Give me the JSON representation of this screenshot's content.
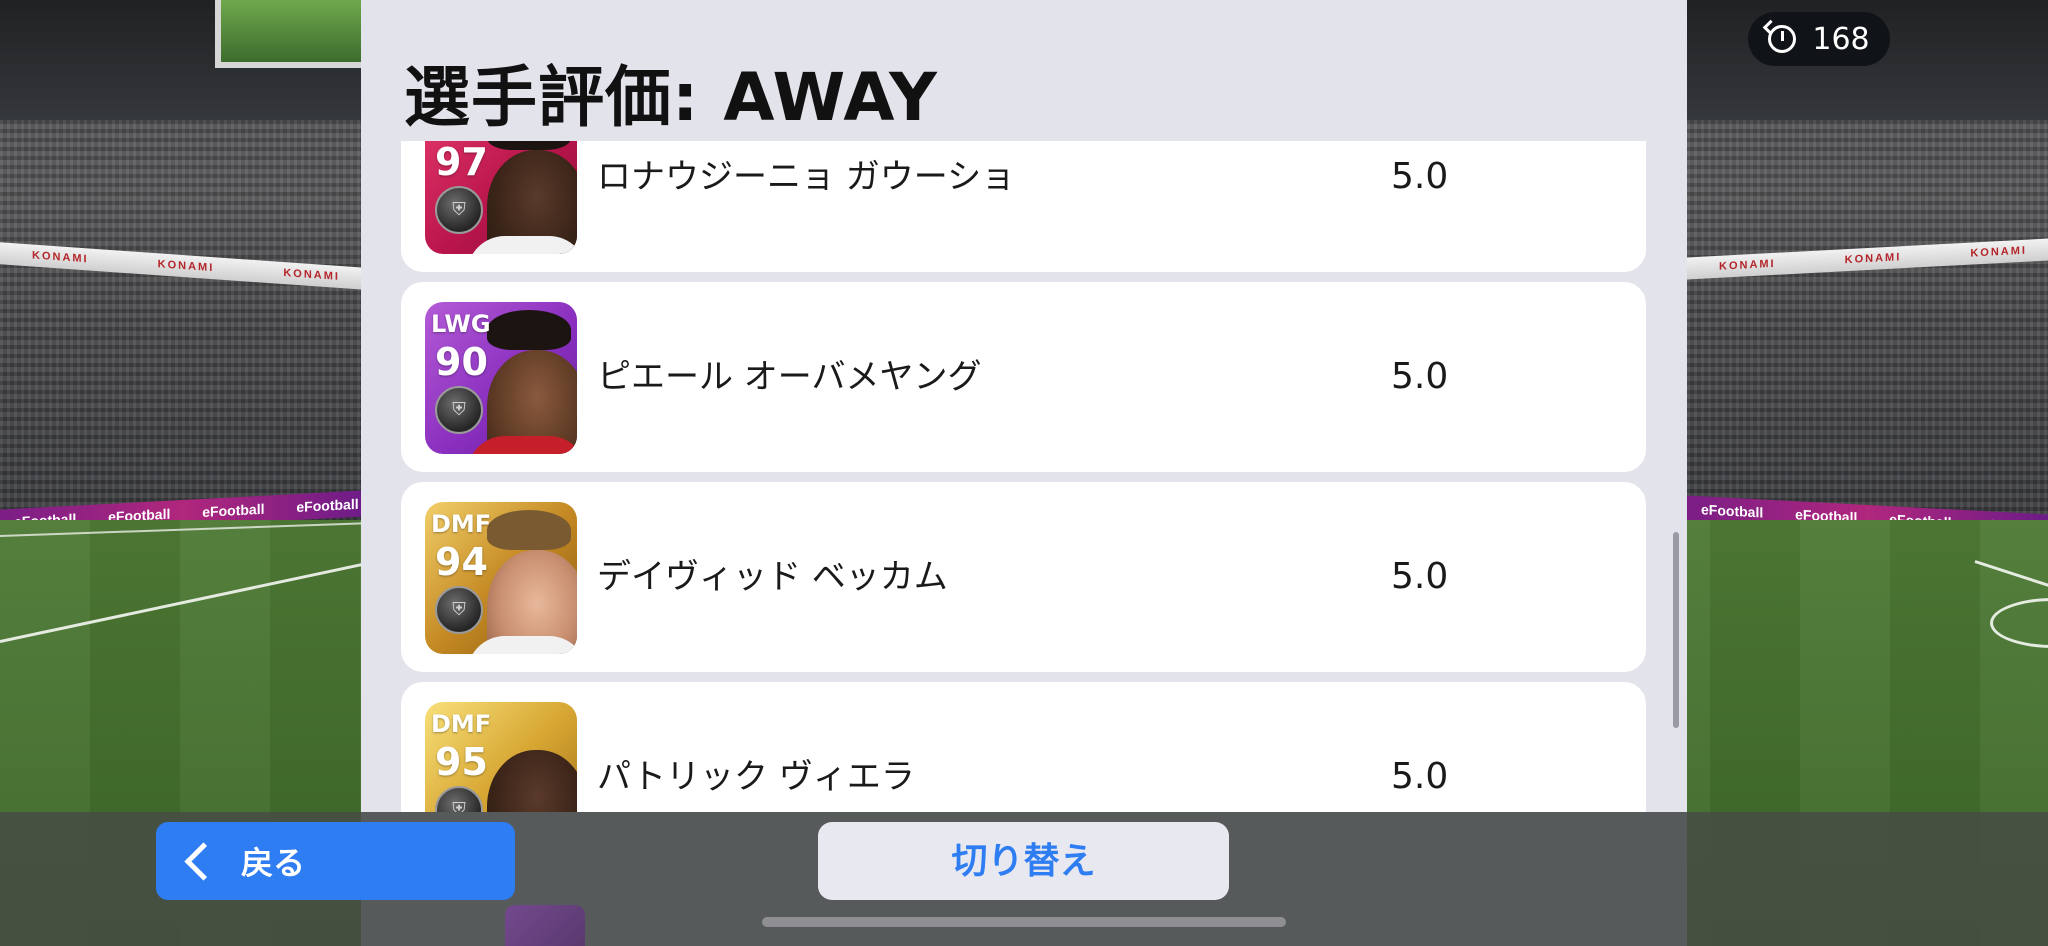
{
  "dialog": {
    "title": "選手評価: AWAY"
  },
  "timer": {
    "icon": "stopwatch-icon",
    "value": "168"
  },
  "players": [
    {
      "position": "",
      "rating": "97",
      "card_color": "pink",
      "name": "ロナウジーニョ ガウーショ",
      "score": "5.0"
    },
    {
      "position": "LWG",
      "rating": "90",
      "card_color": "purple",
      "name": "ピエール オーバメヤング",
      "score": "5.0"
    },
    {
      "position": "DMF",
      "rating": "94",
      "card_color": "gold",
      "name": "デイヴィッド ベッカム",
      "score": "5.0"
    },
    {
      "position": "DMF",
      "rating": "95",
      "card_color": "gold",
      "name": "パトリック ヴィエラ",
      "score": "5.0"
    }
  ],
  "footer": {
    "back_label": "戻る",
    "switch_label": "切り替え"
  },
  "stadium": {
    "sponsor_1": "KONAMI",
    "sponsor_2": "eFootball"
  },
  "colors": {
    "accent": "#2e7df2",
    "dialog_bg": "#e3e3eb",
    "row_bg": "#ffffff"
  }
}
